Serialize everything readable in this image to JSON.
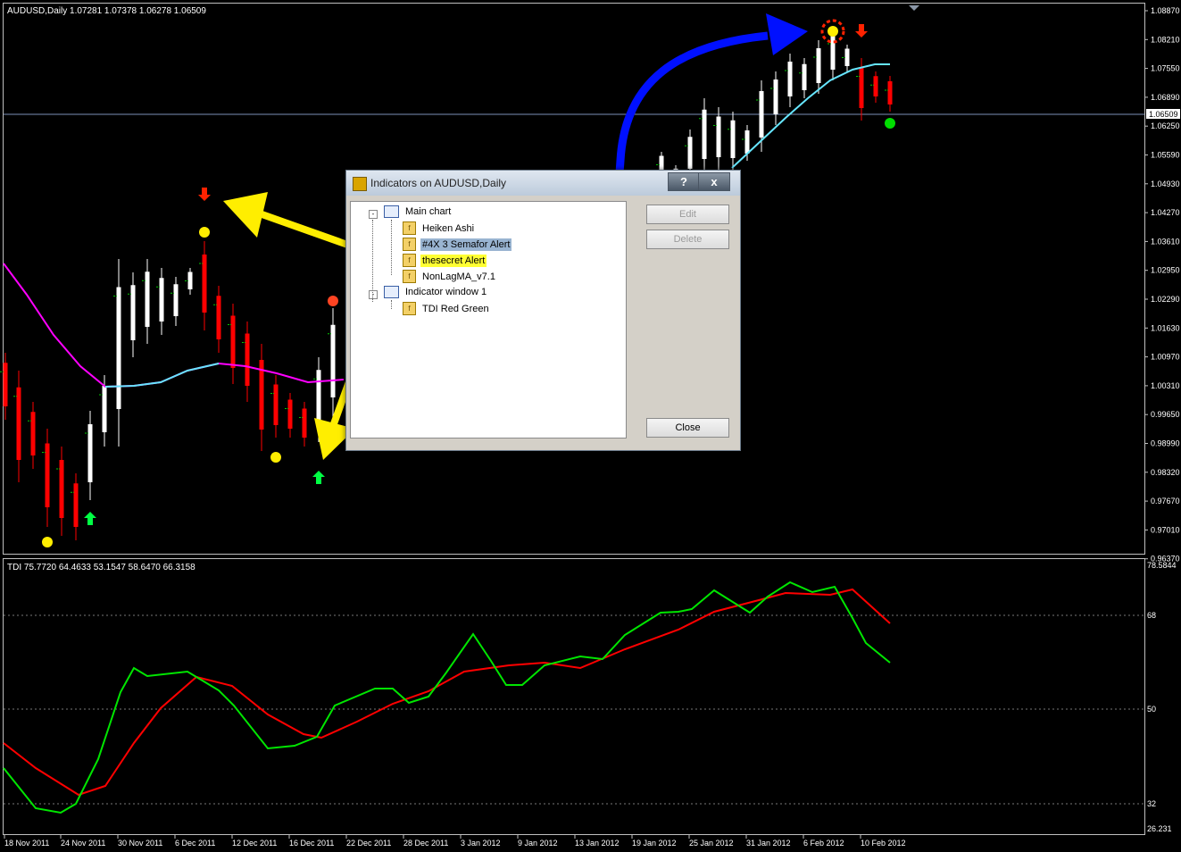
{
  "chart": {
    "header": "AUDUSD,Daily  1.07281 1.07378 1.06278 1.06509",
    "current_price": "1.06509",
    "price_axis": [
      "1.08870",
      "1.08210",
      "1.07550",
      "1.06890",
      "1.06250",
      "1.05590",
      "1.04930",
      "1.04270",
      "1.03610",
      "1.02950",
      "1.02290",
      "1.01630",
      "1.00970",
      "1.00310",
      "0.99650",
      "0.98990",
      "0.98320",
      "0.97670",
      "0.97010",
      "0.96370"
    ],
    "indicator_header": "TDI 75.7720 64.4633 53.1547 58.6470 66.3158",
    "indicator_axis": [
      "78.5844",
      "68",
      "50",
      "32",
      "26.231"
    ],
    "date_axis": [
      "18 Nov 2011",
      "24 Nov 2011",
      "30 Nov 2011",
      "6 Dec 2011",
      "12 Dec 2011",
      "16 Dec 2011",
      "22 Dec 2011",
      "28 Dec 2011",
      "3 Jan 2012",
      "9 Jan 2012",
      "13 Jan 2012",
      "19 Jan 2012",
      "25 Jan 2012",
      "31 Jan 2012",
      "6 Feb 2012",
      "10 Feb 2012"
    ],
    "colors": {
      "bull": "#ffffff",
      "bear": "#ff0000",
      "ma_down": "#ff00ff",
      "ma_up": "#66e6ff",
      "tdi_fast": "#00e600",
      "tdi_slow": "#ff0000",
      "arrow_yellow": "#ffee00",
      "arrow_blue": "#0010ff"
    }
  },
  "dialog": {
    "title": "Indicators on AUDUSD,Daily",
    "help_label": "?",
    "close_x": "x",
    "tree": {
      "main_chart": "Main chart",
      "items": [
        "Heiken Ashi",
        "#4X 3 Semafor Alert",
        "thesecret Alert",
        "NonLagMA_v7.1"
      ],
      "indicator_window": "Indicator window 1",
      "subitems": [
        "TDI Red Green"
      ]
    },
    "buttons": {
      "edit": "Edit",
      "delete": "Delete",
      "close": "Close"
    }
  },
  "chart_data": {
    "type": "line",
    "title": "AUDUSD,Daily",
    "x": [
      "18 Nov 2011",
      "24 Nov 2011",
      "30 Nov 2011",
      "6 Dec 2011",
      "12 Dec 2011",
      "16 Dec 2011",
      "22 Dec 2011",
      "28 Dec 2011",
      "3 Jan 2012",
      "9 Jan 2012",
      "13 Jan 2012",
      "19 Jan 2012",
      "25 Jan 2012",
      "31 Jan 2012",
      "6 Feb 2012",
      "10 Feb 2012"
    ],
    "series": [
      {
        "name": "TDI",
        "values": [
          40,
          31,
          56,
          59,
          52,
          46,
          54,
          56,
          62,
          58,
          60,
          66,
          71,
          70,
          71,
          60
        ]
      }
    ],
    "ylim": [
      26.231,
      78.5844
    ]
  }
}
